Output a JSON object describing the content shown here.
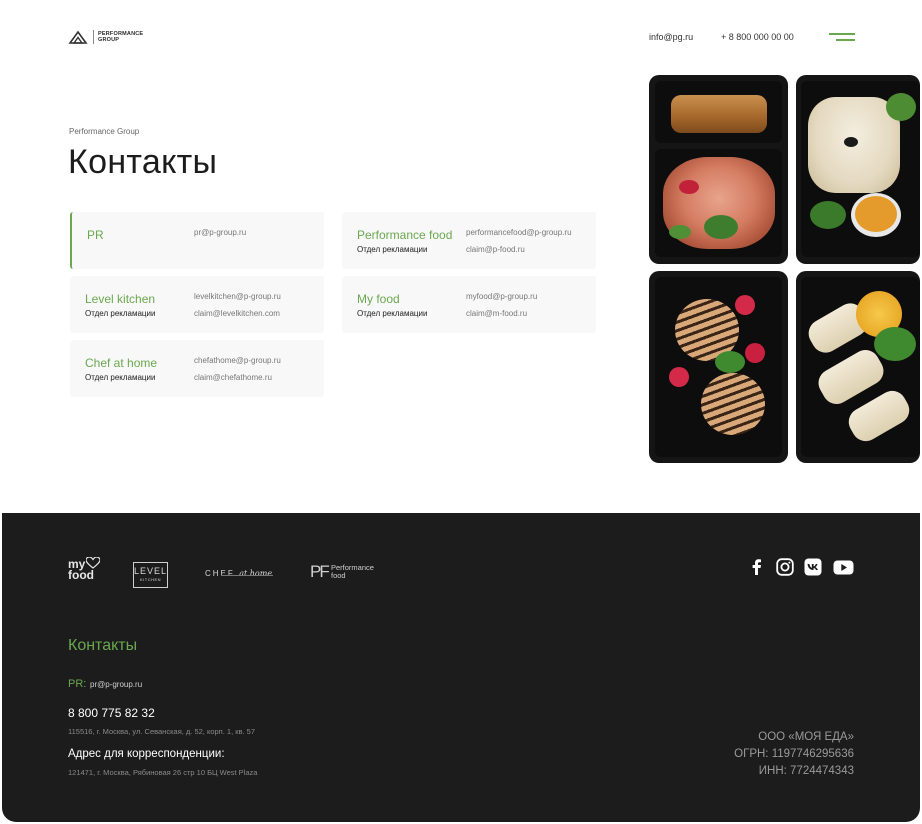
{
  "header": {
    "logo_line1": "PERFORMANCE",
    "logo_line2": "GROUP",
    "email": "info@pg.ru",
    "phone": "+ 8 800 000 00 00",
    "menu_icon": "hamburger-menu-icon"
  },
  "breadcrumb": "Performance Group",
  "title": "Контакты",
  "contacts": [
    {
      "name": "PR",
      "email": "pr@p-group.ru",
      "dept": "",
      "claim": ""
    },
    {
      "name": "Performance food",
      "email": "performancefood@p-group.ru",
      "dept": "Отдел рекламации",
      "claim": "claim@p-food.ru"
    },
    {
      "name": "Level kitchen",
      "email": "levelkitchen@p-group.ru",
      "dept": "Отдел рекламации",
      "claim": "claim@levelkitchen.com"
    },
    {
      "name": "My food",
      "email": "myfood@p-group.ru",
      "dept": "Отдел рекламации",
      "claim": "claim@m-food.ru"
    },
    {
      "name": "Chef at home",
      "email": "chefathome@p-group.ru",
      "dept": "Отдел рекламации",
      "claim": "claim@chefathome.ru"
    }
  ],
  "footer": {
    "brands": {
      "myfood_line1": "my",
      "myfood_line2": "food",
      "level_line1": "LEVEL",
      "level_line2": "KITCHEN",
      "chef": "CHEF",
      "chef_script": "at home",
      "pf_mark": "PF",
      "pf_line1": "Performance",
      "pf_line2": "food"
    },
    "social_icons": [
      "facebook-icon",
      "instagram-icon",
      "vk-icon",
      "youtube-icon"
    ],
    "contacts_title": "Контакты",
    "pr_label": "PR:",
    "pr_email": "pr@p-group.ru",
    "phone": "8 800 775 82 32",
    "address": "115516, г. Москва, ул. Севанская, д. 52, корп. 1, кв. 57",
    "corr_label": "Адрес для корреспонденции:",
    "corr_address": "121471, г. Москва, Рябиновая 26 стр 10 БЦ West Plaza",
    "company": "ООО «МОЯ ЕДА»",
    "ogrn": "ОГРН: 1197746295636",
    "inn": "ИНН: 7724474343"
  },
  "colors": {
    "accent": "#6aa84f",
    "footer_bg": "#1c1c1c",
    "card_bg": "#f8f8f8"
  }
}
